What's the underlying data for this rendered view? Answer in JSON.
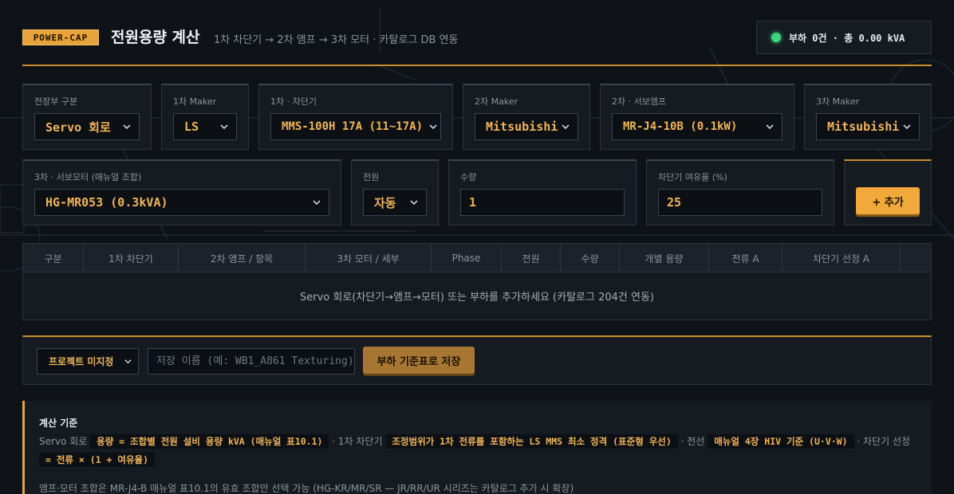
{
  "header": {
    "badge": "POWER-CAP",
    "title": "전원용량 계산",
    "subtitle": "1차 차단기 → 2차 앰프 → 3차 모터 · 카탈로그 DB 연동",
    "status": "부하 0건 · 총 0.00 kVA",
    "status_color": "#3fd37e"
  },
  "fields": {
    "panel_type": {
      "label": "전장부 구분",
      "value": "Servo 회로"
    },
    "maker1": {
      "label": "1차 Maker",
      "value": "LS"
    },
    "breaker1": {
      "label": "1차 · 차단기",
      "value": "MMS-100H 17A (11~17A)"
    },
    "maker2": {
      "label": "2차 Maker",
      "value": "Mitsubishi"
    },
    "amp2": {
      "label": "2차 · 서보앰프",
      "value": "MR-J4-10B (0.1kW)"
    },
    "maker3": {
      "label": "3차 Maker",
      "value": "Mitsubishi"
    },
    "motor3": {
      "label": "3차 · 서보모터 (매뉴얼 조합)",
      "value": "HG-MR053 (0.3kVA)"
    },
    "power": {
      "label": "전원",
      "value": "자동"
    },
    "qty": {
      "label": "수량",
      "value": "1"
    },
    "margin": {
      "label": "차단기 여유율 (%)",
      "value": "25"
    },
    "add_label": "+ 추가"
  },
  "table": {
    "columns": [
      "구분",
      "1차 차단기",
      "2차 앰프 / 항목",
      "3차 모터 / 세부",
      "Phase",
      "전원",
      "수량",
      "개별 용량",
      "전류 A",
      "차단기 선정 A",
      ""
    ],
    "empty_message": "Servo 회로(차단기→앰프→모터) 또는 부하를 추가하세요 (카탈로그 204건 연동)"
  },
  "save": {
    "project": "프로젝트 미지정",
    "placeholder": "저장 이름 (예: WB1_A861 Texturing)",
    "button": "부하 기준표로 저장"
  },
  "basis": {
    "title": "계산 기준",
    "t1": "Servo 회로",
    "c1": "용량 = 조합별 전원 설비 용량 kVA (매뉴얼 표10.1)",
    "t2": "· 1차 차단기",
    "c2": "조정범위가 1차 전류를 포함하는 LS MMS 최소 정격 (표준형 우선)",
    "t3": "· 전선",
    "c3": "매뉴얼 4장 HIV 기준 (U·V·W)",
    "t4": "· 차단기 선정",
    "c4": "= 전류 × (1 + 여유율)",
    "note": "앰프·모터 조합은 MR-J4-B 매뉴얼 표10.1의 유효 조합만 선택 가능 (HG-KR/MR/SR — JR/RR/UR 시리즈는 카탈로그 추가 시 확장)"
  }
}
